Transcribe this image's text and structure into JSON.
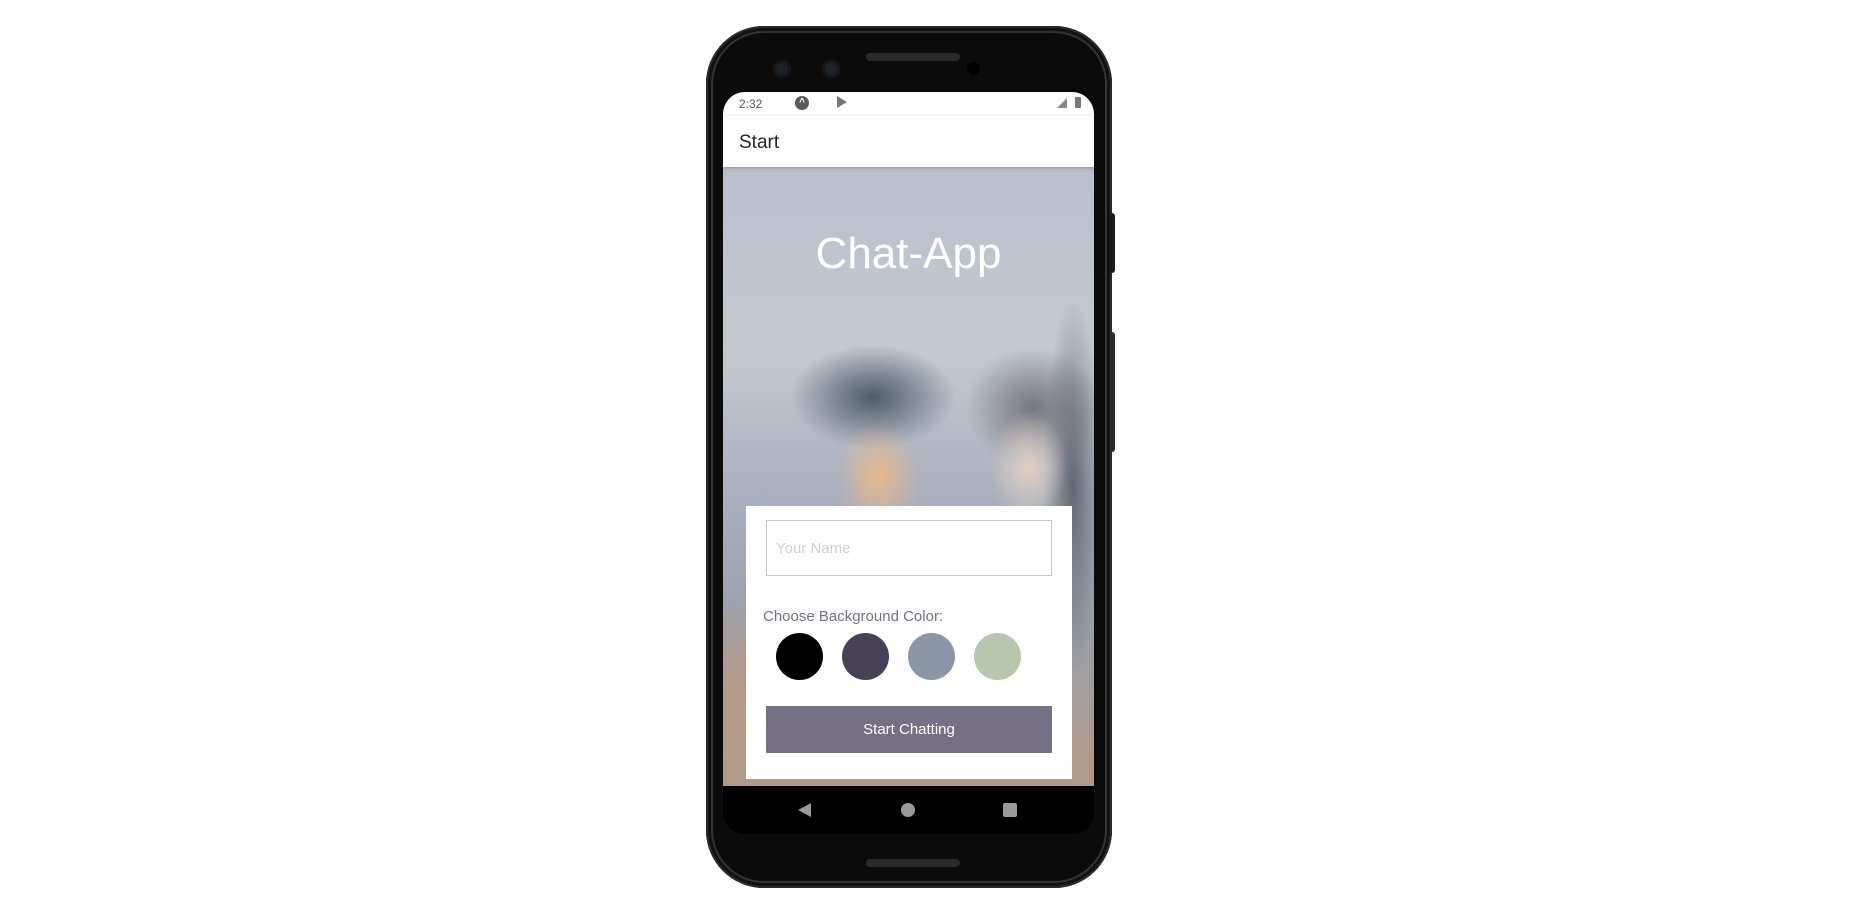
{
  "status_bar": {
    "time": "2:32",
    "icons": [
      "app-a-icon",
      "play-store-icon",
      "signal-icon",
      "battery-icon"
    ]
  },
  "app_bar": {
    "title": "Start"
  },
  "start_screen": {
    "app_title": "Chat-App",
    "name_input": {
      "value": "",
      "placeholder": "Your Name"
    },
    "color_label": "Choose Background Color:",
    "color_options": [
      {
        "name": "black",
        "hex": "#000000"
      },
      {
        "name": "dark-purple",
        "hex": "#474056"
      },
      {
        "name": "grey-blue",
        "hex": "#8A95A5"
      },
      {
        "name": "sage-green",
        "hex": "#B9C6AE"
      }
    ],
    "start_button_label": "Start Chatting",
    "accent_color": "#757083"
  },
  "nav_bar": {
    "buttons": [
      "back",
      "home",
      "recents"
    ]
  }
}
